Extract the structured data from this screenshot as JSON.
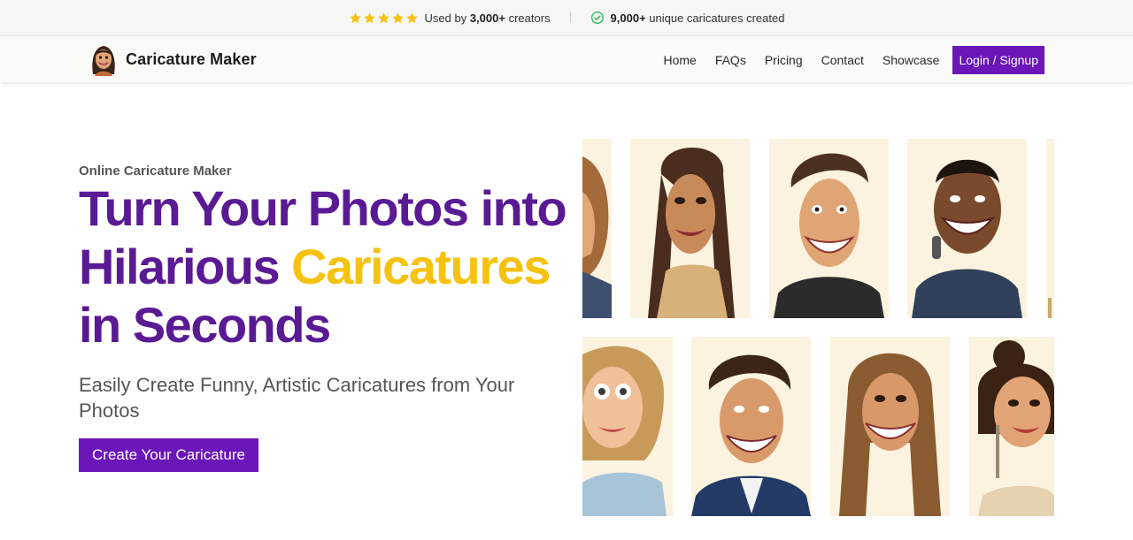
{
  "topbar": {
    "used_by_prefix": "Used by ",
    "used_by_count": "3,000+",
    "used_by_suffix": " creators",
    "created_count": "9,000+",
    "created_suffix": " unique caricatures created",
    "star_color": "#f5c20f",
    "check_color": "#2ebd5a"
  },
  "nav": {
    "brand": "Caricature Maker",
    "items": [
      "Home",
      "FAQs",
      "Pricing",
      "Contact",
      "Showcase"
    ],
    "login_label": "Login / Signup"
  },
  "hero": {
    "eyebrow": "Online Caricature Maker",
    "headline_line1": "Turn Your Photos into",
    "headline_line2_a": "Hilarious ",
    "headline_line2_b": "Caricatures",
    "headline_line3": "in Seconds",
    "subhead": "Easily Create Funny, Artistic Caricatures from Your Photos",
    "cta_label": "Create Your Caricature"
  },
  "colors": {
    "brand_purple": "#6a16b8",
    "headline_purple": "#5a1a94",
    "accent_yellow": "#f5c20f"
  }
}
